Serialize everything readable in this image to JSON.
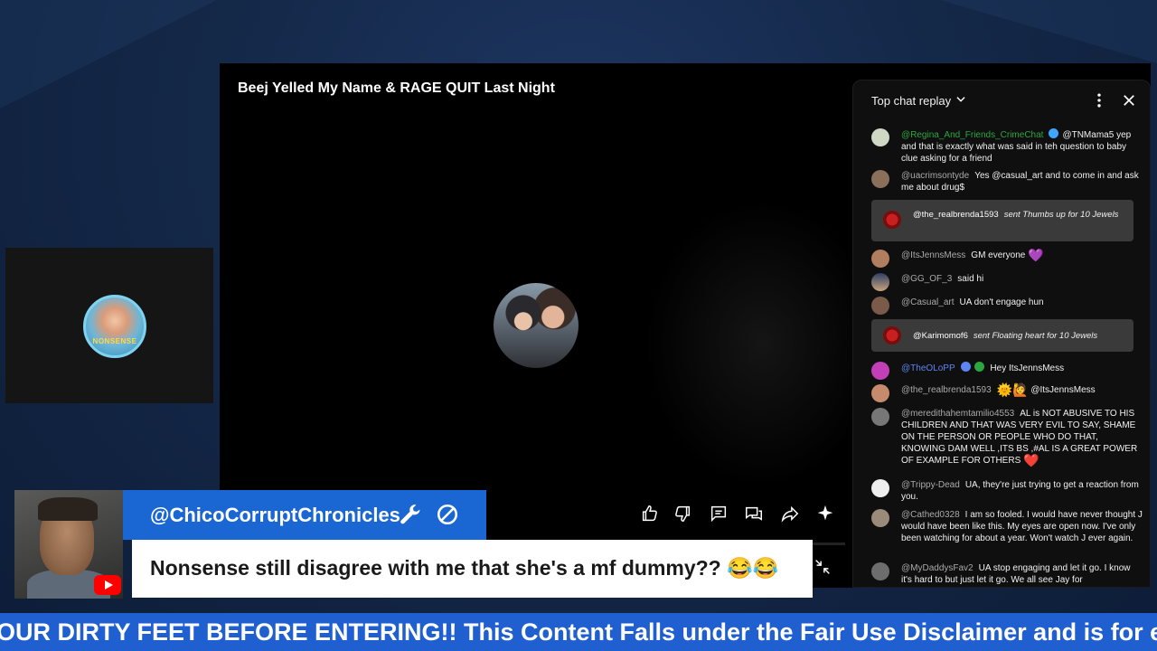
{
  "video": {
    "title": "Beej Yelled My Name & RAGE QUIT Last Night"
  },
  "left_panel": {
    "avatar_text": "NONSENSE"
  },
  "controls": [
    "like-icon",
    "dislike-icon",
    "comment-icon",
    "chat-icon",
    "share-icon",
    "sparkle-icon"
  ],
  "chat": {
    "title": "Top chat replay",
    "messages": [
      {
        "author": "@Regina_And_Friends_CrimeChat",
        "mention": "@TNMama5",
        "text": "yep and that is exactly what was said in teh question to baby clue asking for a friend"
      },
      {
        "author": "@uacrimsontyde",
        "text": "Yes @casual_art and to come in and ask me about drug$"
      },
      {
        "author": "@ItsJennsMess",
        "text": "GM everyone",
        "emoji": "💜"
      },
      {
        "author": "@GG_OF_3",
        "text": "said hi"
      },
      {
        "author": "@Casual_art",
        "text": "UA don't engage hun"
      },
      {
        "author": "@TheOLoPP",
        "text": "Hey ItsJennsMess"
      },
      {
        "author": "@the_realbrenda1593",
        "emoji": "🌞🙋",
        "text": "@ItsJennsMess"
      },
      {
        "author": "@meredithahemtamilio4553",
        "text": "AL is NOT ABUSIVE TO HIS CHILDREN AND THAT WAS VERY EVIL TO SAY, SHAME ON THE PERSON OR PEOPLE WHO DO THAT, KNOWING DAM WELL ,ITS BS ,#AL IS A GREAT POWER OF EXAMPLE FOR OTHERS",
        "emoji": "❤️"
      },
      {
        "author": "@Trippy-Dead",
        "text": "UA, they're just trying to get a reaction from you."
      },
      {
        "author": "@Cathed0328",
        "text": "I am so fooled. I would have never thought J would have been like this. My eyes are open now. I've only been watching for about a year. Won't watch J ever again."
      },
      {
        "author": "@MyDaddysFav2",
        "text": "UA stop engaging and let it go. I know it's hard to but just let it go. We all see Jay for"
      }
    ],
    "gifts": [
      {
        "author": "@the_realbrenda1593",
        "text": "sent Thumbs up for 10 Jewels"
      },
      {
        "author": "@Karimomof6",
        "text": "sent Floating heart for 10 Jewels"
      }
    ]
  },
  "overlay": {
    "channel": "@ChicoCorruptChronicles",
    "comment": "Nonsense still disagree with me that she's a mf dummy?? 😂😂"
  },
  "ticker": {
    "text": "OUR DIRTY FEET BEFORE ENTERING!! This Content Falls under the Fair Use Disclaimer and is for education"
  },
  "colors": {
    "accent_blue": "#1a66d2",
    "ticker_blue": "#1f5fd0",
    "background": "#142848",
    "chat_bg": "#0f0f0f"
  }
}
